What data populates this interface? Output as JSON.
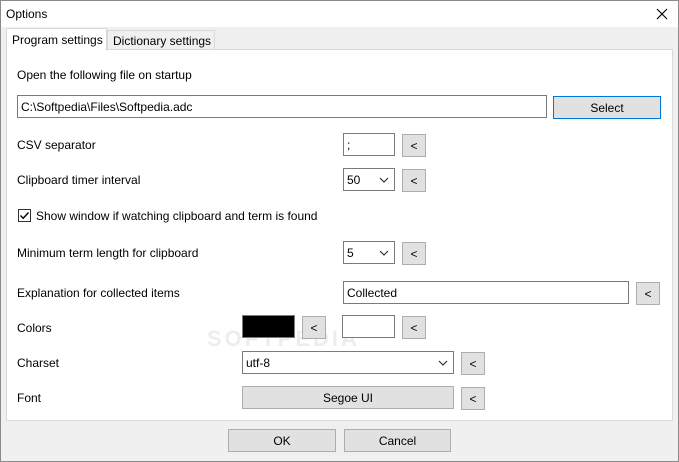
{
  "window": {
    "title": "Options"
  },
  "tabs": [
    {
      "label": "Program settings",
      "active": true
    },
    {
      "label": "Dictionary settings",
      "active": false
    }
  ],
  "startup": {
    "label": "Open the following file on startup",
    "file_value": "C:\\Softpedia\\Files\\Softpedia.adc",
    "select_label": "Select"
  },
  "csv": {
    "label": "CSV separator",
    "value": ";",
    "reset_label": "<"
  },
  "clipboard_timer": {
    "label": "Clipboard timer interval",
    "value": "50",
    "reset_label": "<"
  },
  "show_window": {
    "label": "Show window if watching clipboard and term is found",
    "checked": true
  },
  "min_term": {
    "label": "Minimum term length for clipboard",
    "value": "5",
    "reset_label": "<"
  },
  "explanation": {
    "label": "Explanation for collected items",
    "value": "Collected",
    "reset_label": "<"
  },
  "colors": {
    "label": "Colors",
    "color1": "#000000",
    "color1_reset": "<",
    "color2": "#ffffff",
    "color2_reset": "<"
  },
  "charset": {
    "label": "Charset",
    "value": "utf-8",
    "reset_label": "<"
  },
  "font": {
    "label": "Font",
    "value": "Segoe UI",
    "reset_label": "<"
  },
  "footer": {
    "ok_label": "OK",
    "cancel_label": "Cancel"
  },
  "watermark": "SOFTPEDIA",
  "colors_ui": {
    "accent": "#0078d7",
    "panel": "#ffffff",
    "chrome": "#f0f0f0"
  }
}
